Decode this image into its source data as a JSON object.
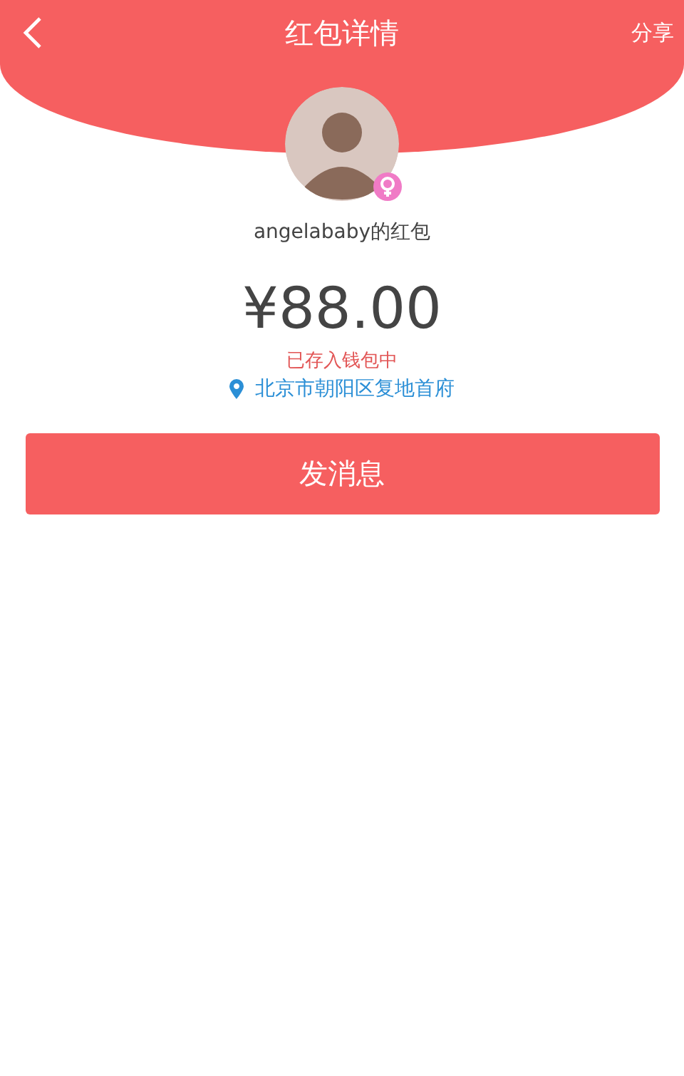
{
  "header": {
    "title": "红包详情",
    "share": "分享"
  },
  "sender": {
    "name": "angelababy的红包"
  },
  "amount": "¥88.00",
  "status": "已存入钱包中",
  "location": "北京市朝阳区复地首府",
  "button": "发消息"
}
